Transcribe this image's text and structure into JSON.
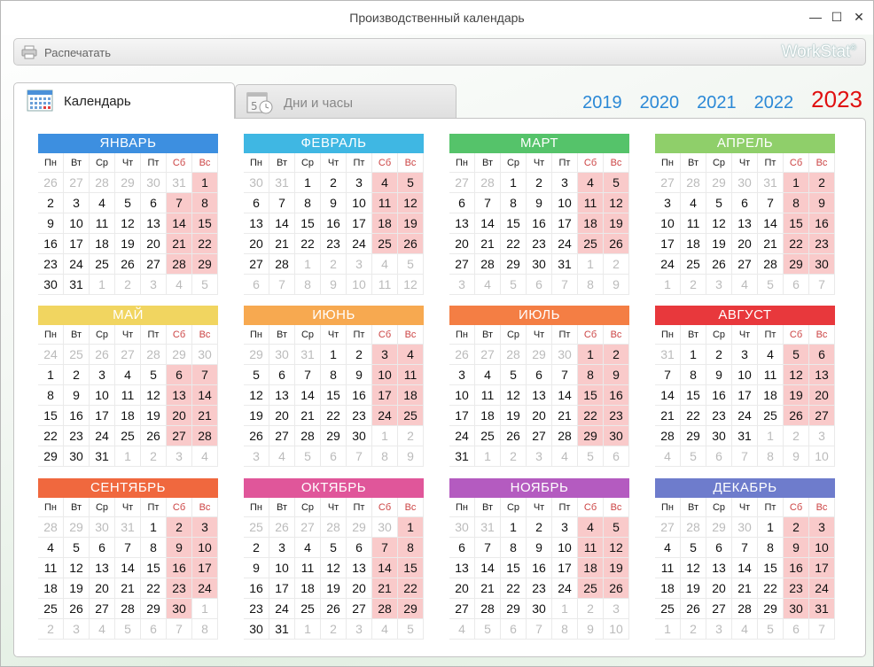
{
  "window": {
    "title": "Производственный календарь"
  },
  "toolbar": {
    "print_label": "Распечатать",
    "brand_work": "Work",
    "brand_stat": "Stat",
    "brand_reg": "®"
  },
  "tabs": [
    {
      "label": "Календарь",
      "active": true
    },
    {
      "label": "Дни и часы",
      "active": false
    }
  ],
  "tab_icons": {
    "calendar": "calendar-icon",
    "days_hours": "calendar-clock-icon"
  },
  "years": [
    "2019",
    "2020",
    "2021",
    "2022",
    "2023"
  ],
  "selected_year": "2023",
  "weekday_labels": [
    "Пн",
    "Вт",
    "Ср",
    "Чт",
    "Пт",
    "Сб",
    "Вс"
  ],
  "colors": {
    "year_link": "#2a88d6",
    "year_selected": "#e01010",
    "weekend_fill": "#f9caca",
    "weekend_header_text": "#cc4444"
  },
  "months": [
    {
      "name": "ЯНВАРЬ",
      "color": "#3d8fe0",
      "prev_days": [
        "26",
        "27",
        "28",
        "29",
        "30",
        "31"
      ],
      "days": 31
    },
    {
      "name": "ФЕВРАЛЬ",
      "color": "#3fb7e3",
      "prev_days": [
        "30",
        "31"
      ],
      "days": 28
    },
    {
      "name": "МАРТ",
      "color": "#55c36a",
      "prev_days": [
        "27",
        "28"
      ],
      "days": 31
    },
    {
      "name": "АПРЕЛЬ",
      "color": "#8fcf6a",
      "prev_days": [
        "27",
        "28",
        "29",
        "30",
        "31"
      ],
      "days": 30
    },
    {
      "name": "МАЙ",
      "color": "#f1d560",
      "prev_days": [
        "24",
        "25",
        "26",
        "27",
        "28",
        "29",
        "30"
      ],
      "days": 31
    },
    {
      "name": "ИЮНЬ",
      "color": "#f7a950",
      "prev_days": [
        "29",
        "30",
        "31"
      ],
      "days": 30
    },
    {
      "name": "ИЮЛЬ",
      "color": "#f47e44",
      "prev_days": [
        "26",
        "27",
        "28",
        "29",
        "30"
      ],
      "days": 31
    },
    {
      "name": "АВГУСТ",
      "color": "#e8383c",
      "prev_days": [
        "31"
      ],
      "days": 31
    },
    {
      "name": "СЕНТЯБРЬ",
      "color": "#f0683e",
      "prev_days": [
        "28",
        "29",
        "30",
        "31"
      ],
      "days": 30
    },
    {
      "name": "ОКТЯБРЬ",
      "color": "#e0569a",
      "prev_days": [
        "25",
        "26",
        "27",
        "28",
        "29",
        "30"
      ],
      "days": 31
    },
    {
      "name": "НОЯБРЬ",
      "color": "#b45bc0",
      "prev_days": [
        "30",
        "31"
      ],
      "days": 30
    },
    {
      "name": "ДЕКАБРЬ",
      "color": "#6e7ccc",
      "prev_days": [
        "27",
        "28",
        "29",
        "30"
      ],
      "days": 31
    }
  ]
}
